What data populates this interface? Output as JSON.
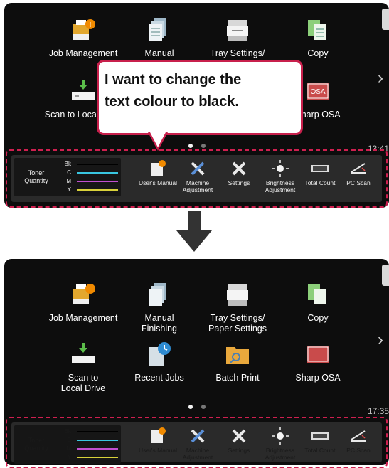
{
  "before": {
    "apps": [
      "Job Management",
      "Manual",
      "Tray Settings/",
      "Copy",
      "Scan to Local Drive",
      "Sharp OSA"
    ],
    "clock": "13:41"
  },
  "callout": {
    "line1": "I want to change the",
    "line2": "text colour to black."
  },
  "after": {
    "apps": [
      "Job Management",
      "Manual Finishing",
      "Tray Settings/ Paper Settings",
      "Copy",
      "Scan to Local Drive",
      "Recent Jobs",
      "Batch Print",
      "Sharp OSA"
    ],
    "clock": "17:35"
  },
  "toner": {
    "label": "Toner Quantity",
    "channels": [
      "Bk",
      "C",
      "M",
      "Y"
    ]
  },
  "dock_items": [
    "User's Manual",
    "Machine Adjustment",
    "Settings",
    "Brightness Adjustment",
    "Total Count",
    "PC Scan"
  ],
  "icons": {
    "job_management": "printer-notification-icon",
    "manual": "document-stack-icon",
    "tray": "copier-tray-icon",
    "copy": "copy-pages-icon",
    "scan": "scan-to-drive-icon",
    "recent": "recent-jobs-clock-icon",
    "batch": "folder-magnifier-icon",
    "osa": "sharp-osa-icon",
    "users_manual": "manual-book-icon",
    "machine_adjustment": "wrench-screwdriver-icon",
    "settings": "tools-icon",
    "brightness": "sun-icon",
    "total_count": "counter-icon",
    "pc_scan": "scanner-icon",
    "next": "chevron-right-icon",
    "arrow": "down-arrow-icon"
  },
  "colors": {
    "screen_bg": "#0d0d0d",
    "accent": "#c8204c",
    "dock_bg": "#2a2a2a",
    "toner_bk": "#000000",
    "toner_c": "#39c6e0",
    "toner_m": "#c14fcf",
    "toner_y": "#d8d13a"
  }
}
